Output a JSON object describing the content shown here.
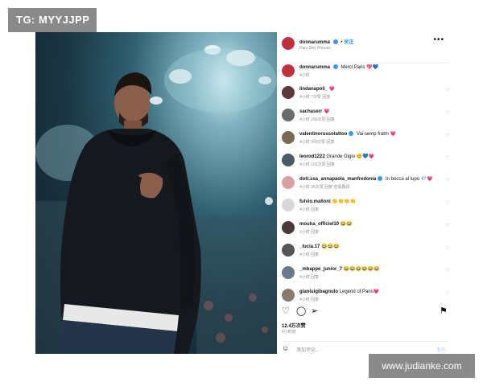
{
  "watermarks": {
    "top_left": "TG: MYYJJPP",
    "bottom_right": "www.judianke.com"
  },
  "header": {
    "username": "donnarumma",
    "follow_dot": "•",
    "follow_label": "关注",
    "location": "Parc Des Princes",
    "more_label": "•••"
  },
  "caption": {
    "username": "donnarumma",
    "text": "Merci Paris 💖💙",
    "time": "4小时"
  },
  "comments": [
    {
      "username": "lindanapoli_",
      "text": "💗",
      "meta": "4小时   7次赞   回复"
    },
    {
      "username": "sachaserr",
      "text": "💗",
      "meta": "4小时   266次赞   回复"
    },
    {
      "username": "valentinorussotattoo",
      "verified": true,
      "text": "Vai semp fratm 💗",
      "meta": "4小时   3列次赞   回复"
    },
    {
      "username": "leorod1222",
      "text": "Grande Gigio 😊💙💗",
      "meta": "4小时   102次赞   回复"
    },
    {
      "username": "dott.ssa_annapaola_manfredonia",
      "verified": true,
      "text": "In bocca al lupo 💎💗",
      "meta": "4小时   95次赞   回复   查看翻译"
    },
    {
      "username": "fulvio.malloni",
      "text": "👏👏👏👏",
      "meta": "4小时   回复"
    },
    {
      "username": "mouha_officiel10",
      "text": "😂😂",
      "meta": "1小时   回复"
    },
    {
      "username": "_lucia.17",
      "text": "😂😂😂",
      "meta": "4小时   回复"
    },
    {
      "username": "_mbappe_junior_7",
      "text": "😂😂😂😂😂😂",
      "meta": "4小时   回复"
    },
    {
      "username": "gianluigibagnulo",
      "text": "Legend of Paris💗",
      "meta": "4小时   回复"
    }
  ],
  "actions": {
    "like_icon": "♡",
    "comment_icon": "◯",
    "share_icon": "➢",
    "save_icon": "⚑"
  },
  "likes": "12.4万次赞",
  "post_time": "4小时前",
  "add_comment": {
    "emoji": "☺",
    "placeholder": "添加评论...",
    "post_label": "发布"
  },
  "colors": {
    "accent_red": "#e0245e",
    "verified_blue": "#3897f0",
    "meta_gray": "#8e8e8e"
  }
}
